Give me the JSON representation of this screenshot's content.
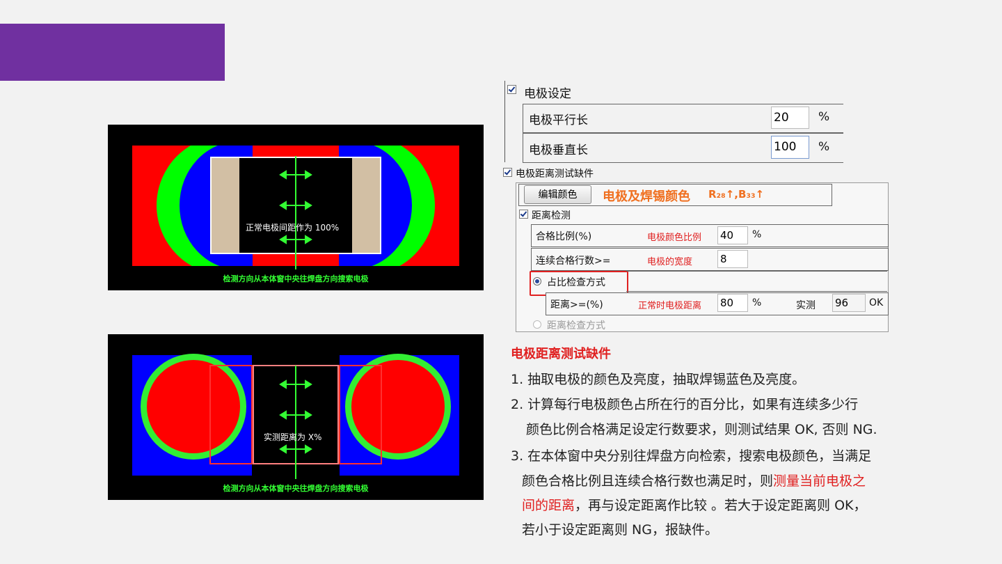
{
  "diagram1": {
    "center_label": "正常电极间距作为 100%",
    "caption": "检测方向从本体窗中央往焊盘方向搜索电极"
  },
  "diagram2": {
    "center_label": "实测距离为 X%",
    "caption": "检测方向从本体窗中央往焊盘方向搜索电极"
  },
  "panel": {
    "electrode_settings": {
      "label": "电极设定",
      "parallel_label": "电极平行长",
      "parallel_value": "20",
      "vertical_label": "电极垂直长",
      "vertical_value": "100",
      "unit": "%"
    },
    "distance_test": {
      "label": "电极距离测试缺件",
      "edit_color_button": "编辑颜色",
      "color_note": "电极及焊锡颜色",
      "channel_note": "R₂₈↑,B₃₃↑",
      "distance_detect_label": "距离检测",
      "pass_ratio_label": "合格比例(%)",
      "pass_ratio_note": "电极颜色比例",
      "pass_ratio_value": "40",
      "consecutive_label": "连续合格行数>=",
      "consecutive_note": "电极的宽度",
      "consecutive_value": "8",
      "ratio_mode_label": "占比检查方式",
      "distance_label": "距离>=(%)",
      "distance_note": "正常时电极距离",
      "distance_value": "80",
      "measured_label": "实测",
      "measured_value": "96",
      "ok_label": "OK",
      "distance_mode_label": "距离检查方式",
      "unit": "%"
    }
  },
  "text": {
    "heading": "电极距离测试缺件",
    "line1": "1. 抽取电极的颜色及亮度，抽取焊锡蓝色及亮度。",
    "line2": "2. 计算每行电极颜色占所在行的百分比，如果有连续多少行",
    "line3": "颜色比例合格满足设定行数要求，则测试结果 OK, 否则 NG.",
    "line4": "3. 在本体窗中央分别往焊盘方向检索，搜索电极颜色，当满足",
    "line5a": "颜色合格比例且连续合格行数也满足时，则",
    "line5b": "测量当前电极之",
    "line6a": "间的距离",
    "line6b": "，再与设定距离作比较 。若大于设定距离则 OK，",
    "line7": "若小于设定距离则 NG，报缺件。"
  },
  "colors": {
    "accent_purple": "#7030a0",
    "highlight_red": "#e02020",
    "note_orange": "#f07020",
    "diagram_green": "#33ff33"
  }
}
